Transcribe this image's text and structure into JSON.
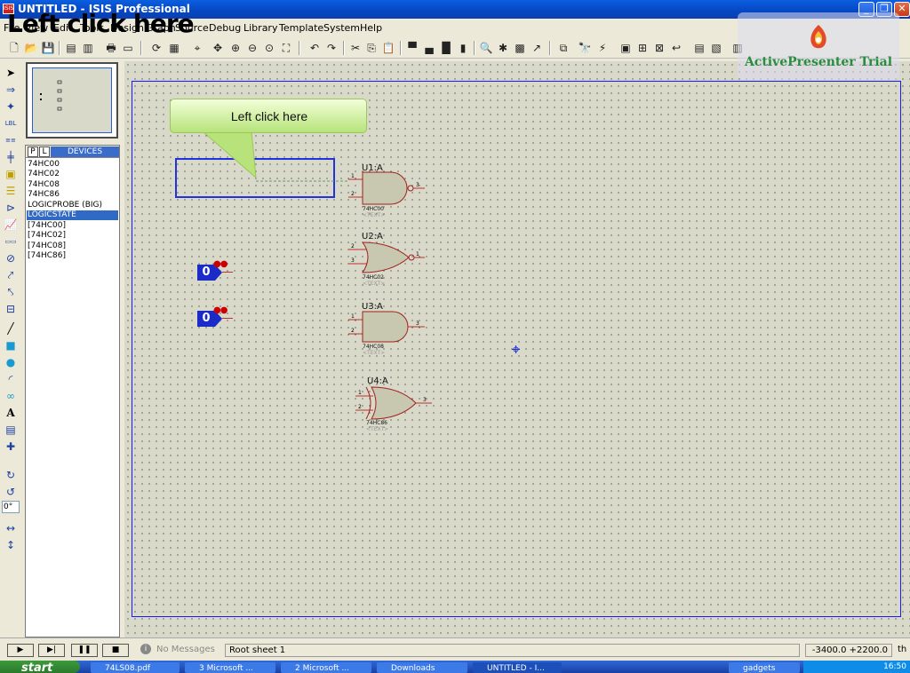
{
  "window": {
    "title": "UNTITLED - ISIS Professional",
    "app_icon": "ISIS"
  },
  "caption_overlay": "Left click here",
  "menu": [
    "File",
    "View",
    "Edit",
    "Tools",
    "Design",
    "Graph",
    "Source",
    "Debug",
    "Library",
    "Template",
    "System",
    "Help"
  ],
  "watermark": {
    "text": "ActivePresenter Trial"
  },
  "device_selector": {
    "tabs": [
      "P",
      "L"
    ],
    "title": "DEVICES",
    "items": [
      "74HC00",
      "74HC02",
      "74HC08",
      "74HC86",
      "LOGICPROBE (BIG)",
      "LOGICSTATE",
      "[74HC00]",
      "[74HC02]",
      "[74HC08]",
      "[74HC86]"
    ],
    "selected": "LOGICSTATE"
  },
  "rotation_value": "0°",
  "callout": {
    "text": "Left click here"
  },
  "gates": [
    {
      "ref": "U1:A",
      "part": "74HC00",
      "text": "<TEXT>",
      "pins": [
        "1",
        "2",
        "3"
      ]
    },
    {
      "ref": "U2:A",
      "part": "74HC02",
      "text": "<TEXT>",
      "pins": [
        "2",
        "3",
        "1"
      ]
    },
    {
      "ref": "U3:A",
      "part": "74HC08",
      "text": "<TEXT>",
      "pins": [
        "1",
        "2",
        "3"
      ]
    },
    {
      "ref": "U4:A",
      "part": "74HC86",
      "text": "<TEXT>",
      "pins": [
        "1",
        "2",
        "3"
      ]
    }
  ],
  "logic_states": [
    {
      "value": "0"
    },
    {
      "value": "0"
    }
  ],
  "status": {
    "messages": "No Messages",
    "sheet": "Root sheet 1",
    "coords": "-3400.0  +2200.0",
    "unit": "th"
  },
  "taskbar": {
    "start": "start",
    "tasks": [
      "74LS08.pdf",
      "3 Microsoft ...",
      "2 Microsoft ...",
      "Downloads",
      "UNTITLED - I..."
    ],
    "tray_items": [
      "gadgets",
      "16:50"
    ]
  },
  "colors": {
    "selection_blue": "#316ac5",
    "logic_blue": "#1a2bc8",
    "wire_red": "#c03030",
    "sheet_border": "#1a1aff",
    "watermark_green": "#2b8c3e"
  }
}
